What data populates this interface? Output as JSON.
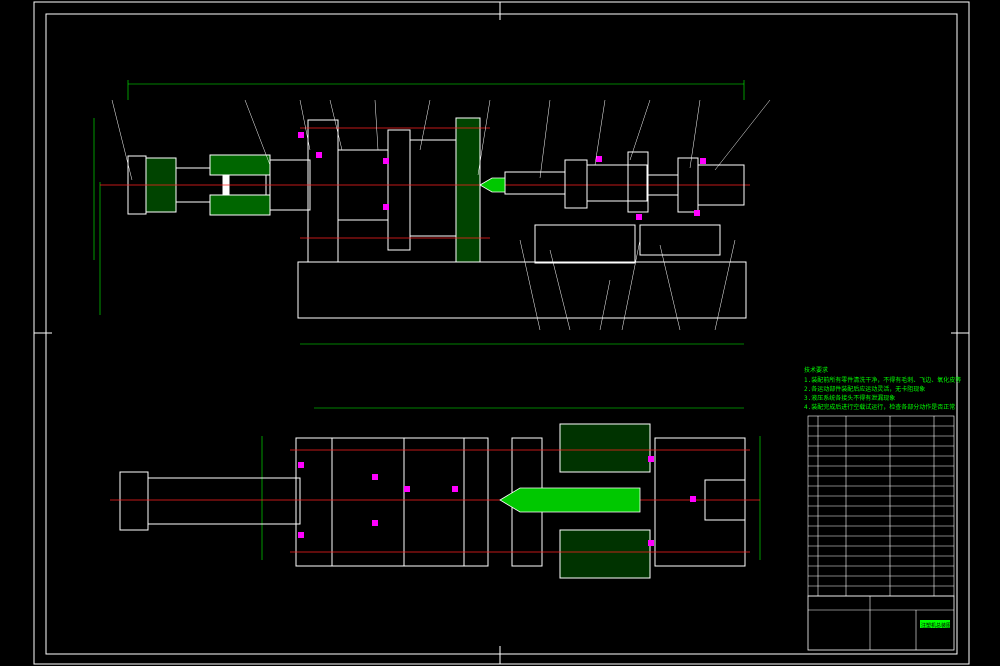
{
  "drawing": {
    "background_color": "#000000",
    "colors": {
      "outline": "#ffffff",
      "centerline": "#ff2020",
      "hatch": "#00c800",
      "dimension": "#00ff00",
      "accent": "#ff00ff",
      "leader": "#ffffff"
    },
    "technical_requirements": {
      "heading": "技术要求",
      "lines": [
        "1.装配前所有零件清洗干净，不得有毛刺、飞边、氧化皮等",
        "2.各运动部件装配后应运动灵活，无卡阻现象",
        "3.液压系统各接头不得有泄漏现象",
        "4.装配完成后进行空载试运行，检查各部分动作是否正常"
      ]
    },
    "title_block": {
      "drawing_name": "注塑机总装图"
    }
  }
}
